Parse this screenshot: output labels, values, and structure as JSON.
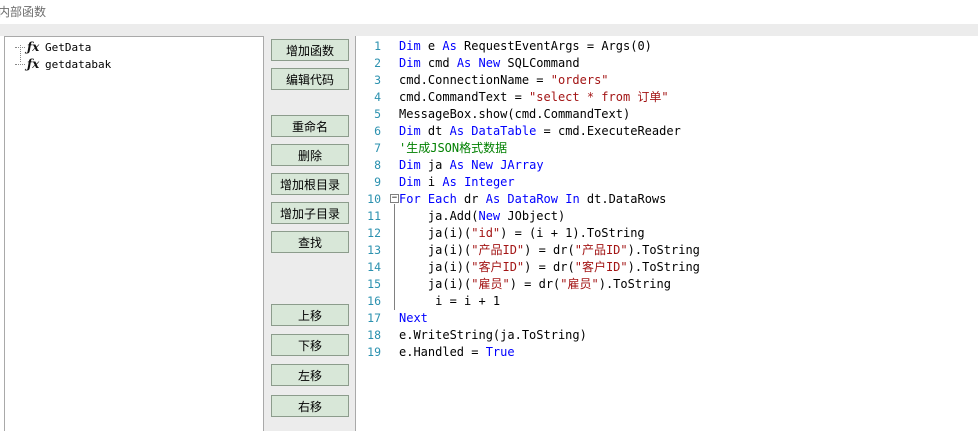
{
  "window": {
    "title": "内部函数"
  },
  "tree": {
    "items": [
      {
        "icon": "fx",
        "label": "GetData"
      },
      {
        "icon": "fx",
        "label": "getdatabak"
      }
    ]
  },
  "buttons": {
    "add_function": "增加函数",
    "edit_code": "编辑代码",
    "rename": "重命名",
    "delete": "删除",
    "add_root_dir": "增加根目录",
    "add_sub_dir": "增加子目录",
    "find": "查找",
    "move_up": "上移",
    "move_down": "下移",
    "move_left": "左移",
    "move_right": "右移"
  },
  "editor": {
    "line_numbers": [
      "1",
      "2",
      "3",
      "4",
      "5",
      "6",
      "7",
      "8",
      "9",
      "10",
      "11",
      "12",
      "13",
      "14",
      "15",
      "16",
      "17",
      "18",
      "19"
    ],
    "lines": [
      "Dim e As RequestEventArgs = Args(0)",
      "Dim cmd As New SQLCommand",
      "cmd.ConnectionName = \"orders\"",
      "cmd.CommandText = \"select * from 订单\"",
      "MessageBox.show(cmd.CommandText)",
      "Dim dt As DataTable = cmd.ExecuteReader",
      "'生成JSON格式数据",
      "Dim ja As New JArray",
      "Dim i As Integer",
      "For Each dr As DataRow In dt.DataRows",
      "    ja.Add(New JObject)",
      "    ja(i)(\"id\") = (i + 1).ToString",
      "    ja(i)(\"产品ID\") = dr(\"产品ID\").ToString",
      "    ja(i)(\"客户ID\") = dr(\"客户ID\").ToString",
      "    ja(i)(\"雇员\") = dr(\"雇员\").ToString",
      "     i = i + 1",
      "Next",
      "e.WriteString(ja.ToString)",
      "e.Handled = True"
    ]
  },
  "colors": {
    "keyword": "#0000ff",
    "string": "#a31515",
    "comment": "#008000",
    "line_number": "#2b91af",
    "button_bg": "#d8e7d8"
  }
}
